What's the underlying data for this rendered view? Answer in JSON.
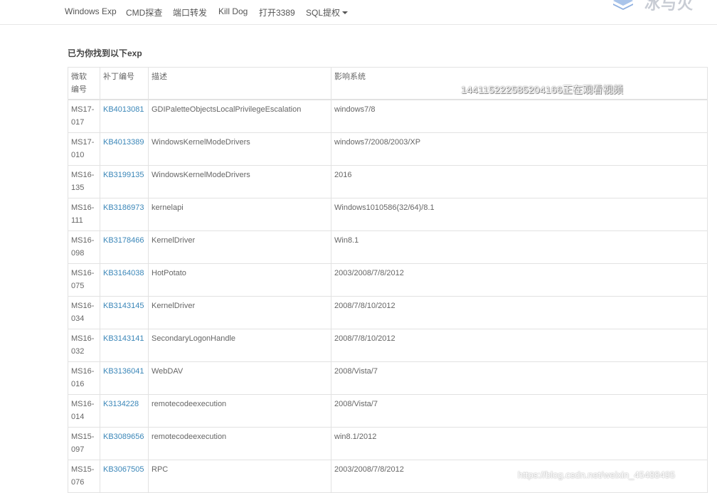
{
  "nav": {
    "items": [
      "Windows Exp",
      "CMD探查",
      "端口转发",
      "Kill Dog",
      "打开3389",
      "SQL提权"
    ]
  },
  "logo": {
    "text": "冰与火",
    "icon": "stacked-layers-icon"
  },
  "heading": "已为你找到以下exp",
  "table": {
    "headers": [
      "微软\n编号",
      "补丁编号",
      "描述",
      "影响系统"
    ],
    "rows": [
      {
        "ms": "MS17-017",
        "kb": "KB4013081",
        "desc": "GDIPaletteObjectsLocalPrivilegeEscalation",
        "sys": "windows7/8"
      },
      {
        "ms": "MS17-010",
        "kb": "KB4013389",
        "desc": "WindowsKernelModeDrivers",
        "sys": "windows7/2008/2003/XP"
      },
      {
        "ms": "MS16-135",
        "kb": "KB3199135",
        "desc": "WindowsKernelModeDrivers",
        "sys": "2016"
      },
      {
        "ms": "MS16-111",
        "kb": "KB3186973",
        "desc": "kernelapi",
        "sys": "Windows1010586(32/64)/8.1"
      },
      {
        "ms": "MS16-098",
        "kb": "KB3178466",
        "desc": "KernelDriver",
        "sys": "Win8.1"
      },
      {
        "ms": "MS16-075",
        "kb": "KB3164038",
        "desc": "HotPotato",
        "sys": "2003/2008/7/8/2012"
      },
      {
        "ms": "MS16-034",
        "kb": "KB3143145",
        "desc": "KernelDriver",
        "sys": "2008/7/8/10/2012"
      },
      {
        "ms": "MS16-032",
        "kb": "KB3143141",
        "desc": "SecondaryLogonHandle",
        "sys": "2008/7/8/10/2012"
      },
      {
        "ms": "MS16-016",
        "kb": "KB3136041",
        "desc": "WebDAV",
        "sys": "2008/Vista/7"
      },
      {
        "ms": "MS16-014",
        "kb": "K3134228",
        "desc": "remotecodeexecution",
        "sys": "2008/Vista/7"
      },
      {
        "ms": "MS15-097",
        "kb": "KB3089656",
        "desc": "remotecodeexecution",
        "sys": "win8.1/2012"
      },
      {
        "ms": "MS15-076",
        "kb": "KB3067505",
        "desc": "RPC",
        "sys": "2003/2008/7/8/2012"
      }
    ]
  },
  "watermark": "144115222585204166正在观看视频",
  "footer_watermark": "https://blog.csdn.net/weixin_45488495",
  "colors": {
    "link": "#3a86b8",
    "border": "#e2e2e2",
    "text": "#666666"
  }
}
